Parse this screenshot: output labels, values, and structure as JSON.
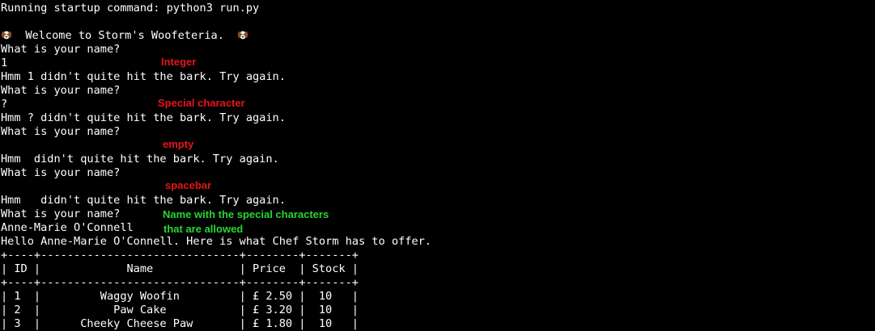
{
  "colors": {
    "background": "#000000",
    "terminal_text": "#ffffff",
    "annotation_error": "#e8141b",
    "annotation_valid": "#27d632"
  },
  "terminal": {
    "startup": "Running startup command: python3 run.py",
    "welcome": "Welcome to Storm's Woofeteria.",
    "welcome_icon": "dog-face-icon",
    "prompt": "What is your name?",
    "inputs": [
      "1",
      "?",
      "",
      "",
      "Anne-Marie O'Connell"
    ],
    "errors": [
      "Hmm 1 didn't quite hit the bark. Try again.",
      "Hmm ? didn't quite hit the bark. Try again.",
      "Hmm  didn't quite hit the bark. Try again.",
      "Hmm   didn't quite hit the bark. Try again."
    ],
    "greeting": "Hello Anne-Marie O'Connell. Here is what Chef Storm has to offer.",
    "table": {
      "border": "+----+------------------------------+--------+-------+",
      "header_row": "| ID |             Name             | Price  | Stock |",
      "rows": [
        "| 1  |         Waggy Woofin         | £ 2.50 |  10   |",
        "| 2  |           Paw Cake           | £ 3.20 |  10   |",
        "| 3  |      Cheeky Cheese Paw       | £ 1.80 |  10   |"
      ]
    }
  },
  "annotations": {
    "integer": "Integer",
    "special_character": "Special character",
    "empty": "empty",
    "spacebar": "spacebar",
    "allowed_line1": "Name with the special characters",
    "allowed_line2": "that are allowed"
  }
}
